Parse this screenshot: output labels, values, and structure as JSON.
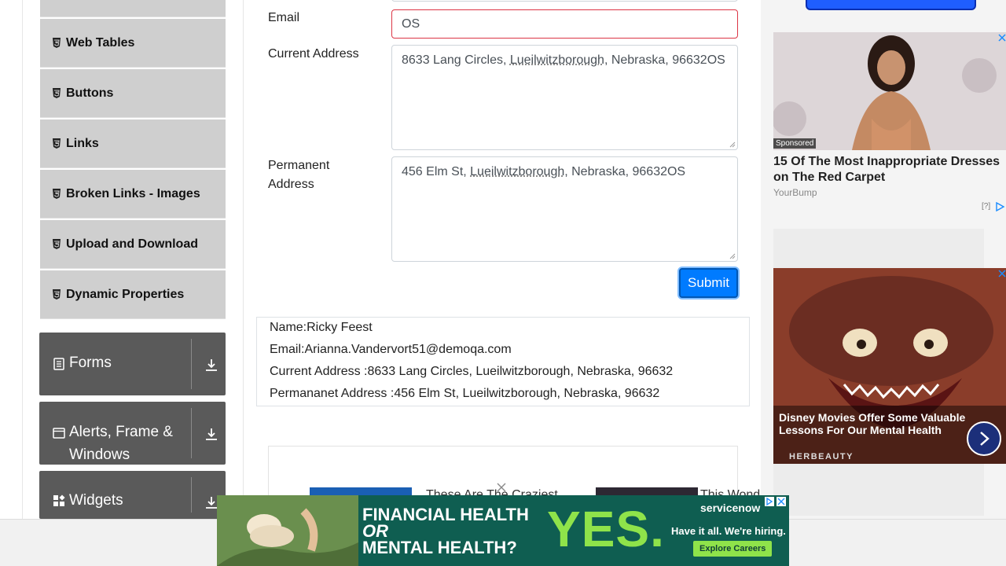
{
  "sidebar": {
    "items": [
      {
        "label": "Web Tables"
      },
      {
        "label": "Buttons"
      },
      {
        "label": "Links"
      },
      {
        "label": "Broken Links - Images"
      },
      {
        "label": "Upload and Download"
      },
      {
        "label": "Dynamic Properties"
      }
    ],
    "groups": [
      {
        "label": "Forms",
        "icon": "form-icon"
      },
      {
        "label": "Alerts, Frame & Windows",
        "icon": "window-icon"
      },
      {
        "label": "Widgets",
        "icon": "widgets-icon"
      }
    ]
  },
  "form": {
    "email_label": "Email",
    "email_value": "OS",
    "current_address_label": "Current Address",
    "current_address_value": {
      "pre": "8633 Lang Circles, ",
      "word": "Lueilwitzborough",
      "post": ", Nebraska, 96632OS"
    },
    "permanent_address_label": "Permanent Address",
    "permanent_address_value": {
      "pre": "456 Elm St, ",
      "word": "Lueilwitzborough",
      "post": ", Nebraska, 96632OS"
    },
    "submit_label": "Submit"
  },
  "output": {
    "name": "Name:Ricky Feest",
    "email": "Email:Arianna.Vandervort51@demoqa.com",
    "current_address": "Current Address :8633 Lang Circles, Lueilwitzborough, Nebraska, 96632",
    "permanent_address": "Permananet Address :456 Elm St, Lueilwitzborough, Nebraska, 96632"
  },
  "promo": {
    "item1": "These Are The Craziest",
    "item2": "This Wond"
  },
  "ads": {
    "ad1": {
      "sponsored": "Sponsored",
      "title": "15 Of The Most Inappropriate Dresses on The Red Carpet",
      "source": "YourBump",
      "adchoice": "[?]"
    },
    "ad2": {
      "title": "Disney Movies Offer Some Valuable Lessons For Our Mental Health",
      "brand": "HERBEAUTY"
    },
    "banner": {
      "line1": "FINANCIAL HEALTH",
      "line2": "OR",
      "line3": "MENTAL HEALTH?",
      "yes": "YES.",
      "brand": "servicenow",
      "tagline": "Have it all. We're hiring.",
      "cta": "Explore Careers"
    }
  },
  "colors": {
    "accent": "#007bff",
    "sidebar_group": "#5a5a5a",
    "error_border": "#dc3545",
    "banner_green": "#8fe34a"
  }
}
